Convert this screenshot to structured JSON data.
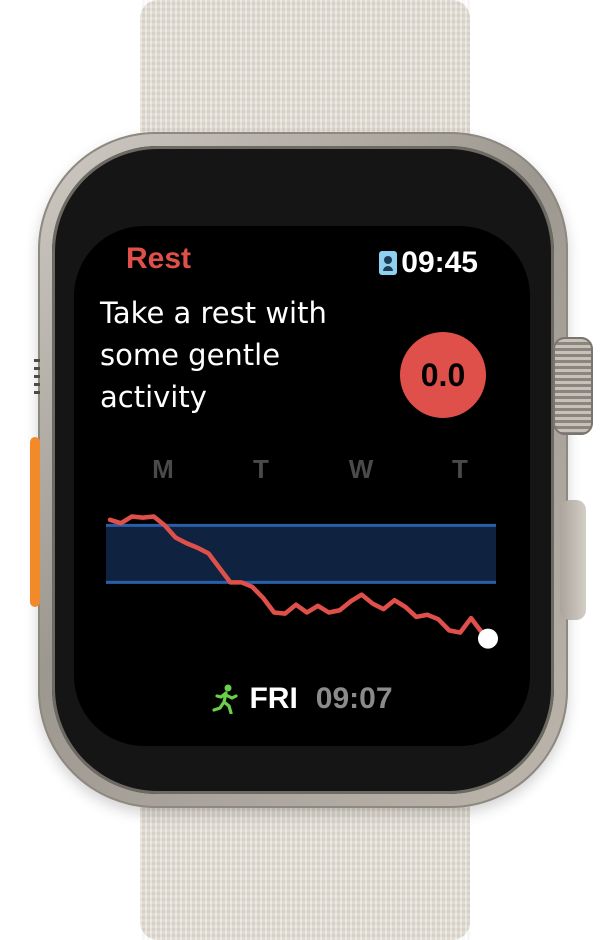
{
  "header": {
    "title": "Rest",
    "clock": "09:45",
    "clock_icon": "contact-badge-icon"
  },
  "main": {
    "message": "Take a rest with some gentle activity",
    "score": "0.0"
  },
  "footer": {
    "activity_icon": "running-figure-icon",
    "day": "FRI",
    "time": "09:07"
  },
  "colors": {
    "accent": "#e0504a",
    "band_fill": "#0f2340",
    "band_line": "#2a5ea8",
    "activity_icon": "#6ad04a",
    "muted_text": "#8b8b8b"
  },
  "chart_data": {
    "type": "line",
    "categories": [
      "M",
      "T",
      "W",
      "T"
    ],
    "band": {
      "low": 0.37,
      "high": 0.88
    },
    "series": [
      {
        "values": [
          0.93,
          0.9,
          0.96,
          0.95,
          0.96,
          0.88,
          0.77,
          0.72,
          0.68,
          0.63,
          0.5,
          0.37,
          0.37,
          0.33,
          0.23,
          0.1,
          0.09,
          0.17,
          0.1,
          0.16,
          0.1,
          0.12,
          0.2,
          0.26,
          0.18,
          0.13,
          0.21,
          0.15,
          0.06,
          0.08,
          0.04,
          -0.06,
          -0.08,
          0.05,
          -0.08
        ]
      }
    ],
    "end_marker": "current-value-dot",
    "ylim": [
      -0.2,
      1.0
    ]
  }
}
